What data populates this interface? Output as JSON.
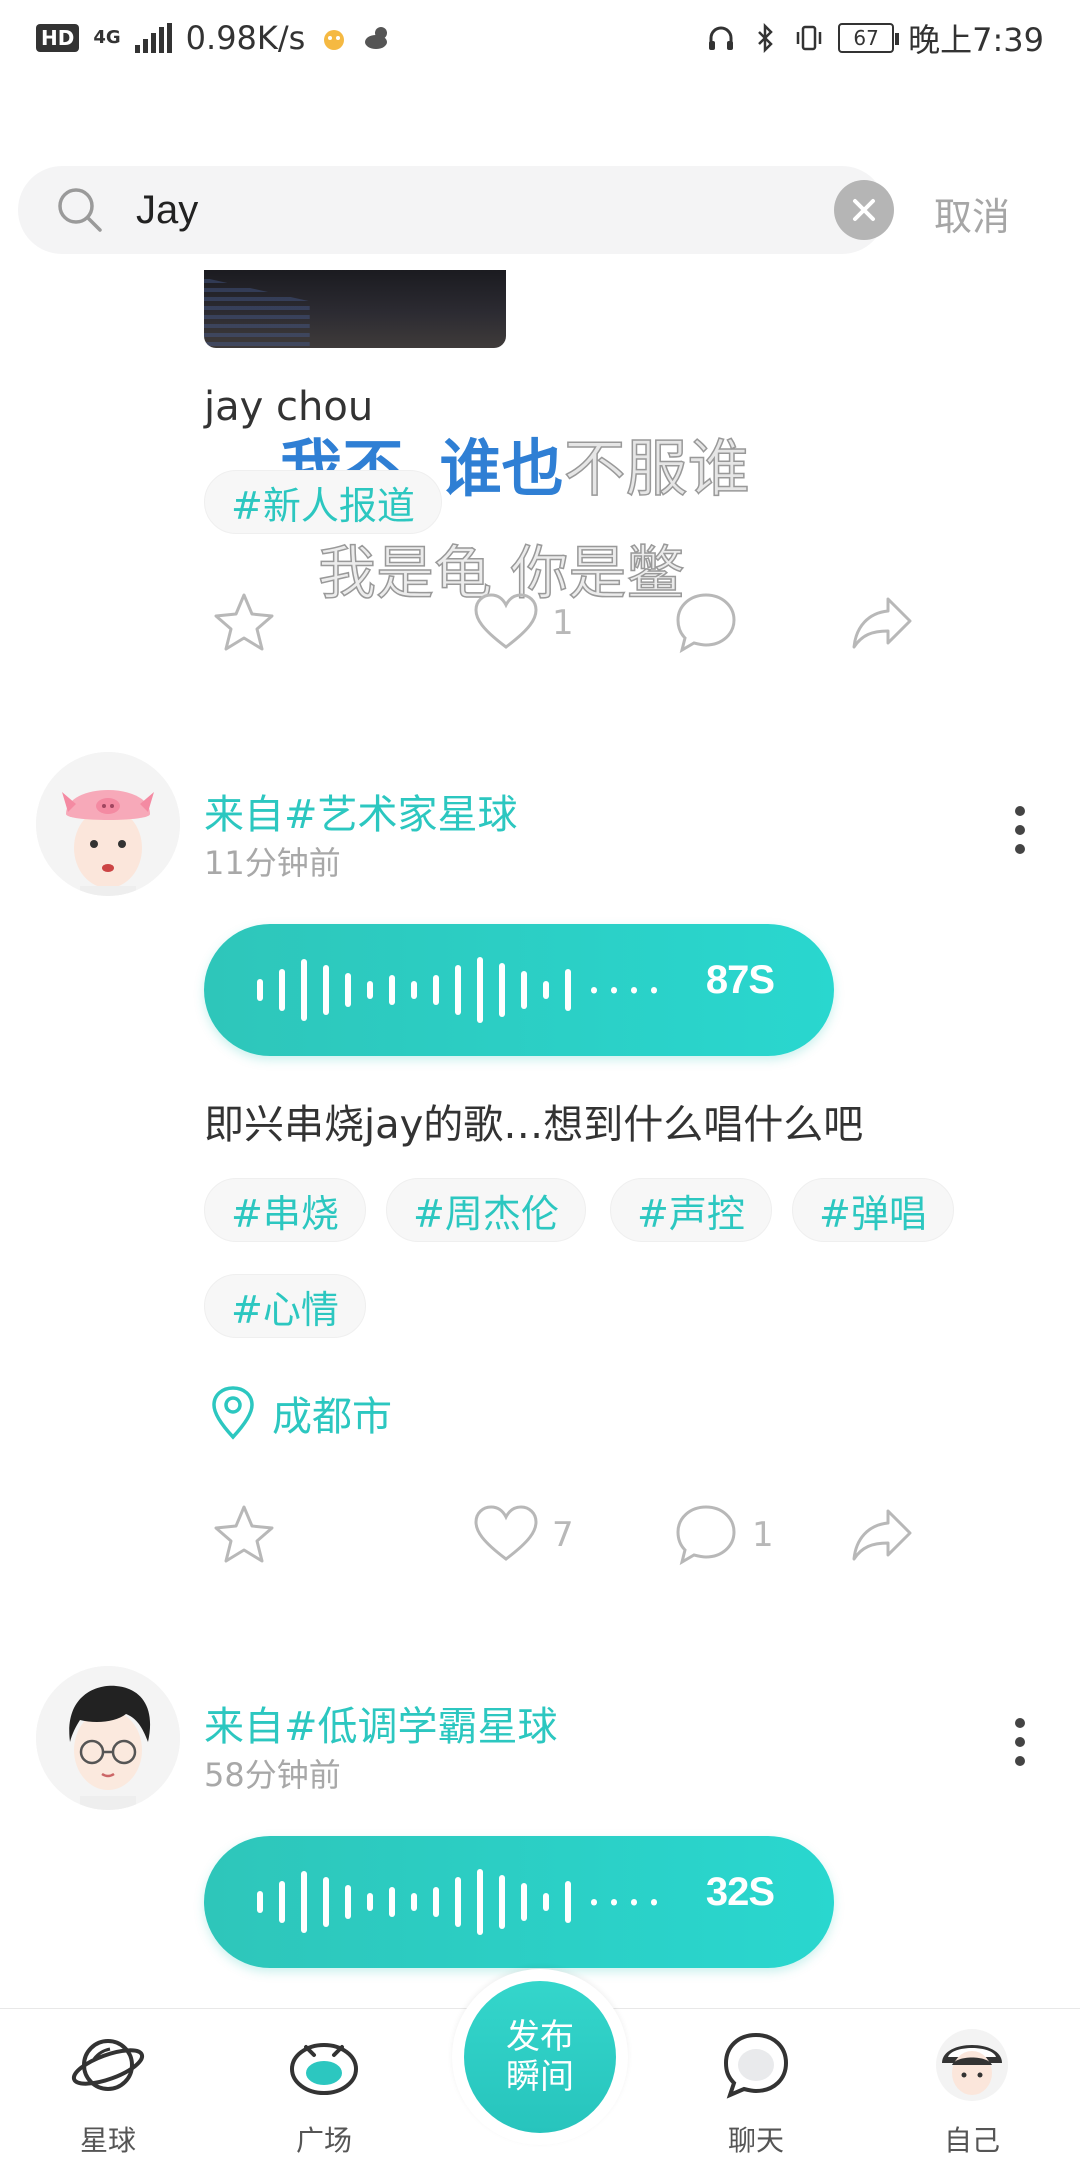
{
  "status_bar": {
    "hd": "HD",
    "network": "4G",
    "speed": "0.98K/s",
    "battery": "67",
    "time": "晚上7:39"
  },
  "search": {
    "query": "Jay",
    "cancel_label": "取消"
  },
  "post_top": {
    "text": "jay chou",
    "overlay_line1_a": "我丕",
    "overlay_line1_b": "谁也",
    "overlay_line1_c": "不服谁",
    "overlay_line2": "我是龟 你是鳖",
    "tags": [
      "#新人报道"
    ],
    "likes": "1"
  },
  "post_1": {
    "from": "来自#艺术家星球",
    "time_ago": "11分钟前",
    "voice_duration": "87S",
    "text": "即兴串烧jay的歌…想到什么唱什么吧",
    "tags": [
      "#串烧",
      "#周杰伦",
      "#声控",
      "#弹唱",
      "#心情"
    ],
    "location": "成都市",
    "likes": "7",
    "comments": "1"
  },
  "post_2": {
    "from": "来自#低调学霸星球",
    "time_ago": "58分钟前",
    "voice_duration": "32S"
  },
  "bottom_nav": {
    "items": [
      "星球",
      "广场",
      "聊天",
      "自己"
    ],
    "publish": "发布瞬间"
  },
  "colors": {
    "accent": "#2cc7c0",
    "overlay_blue": "#2f7fd4",
    "muted": "#b8b8b8"
  },
  "icons": [
    "search-icon",
    "clear-icon",
    "star-icon",
    "heart-icon",
    "comment-icon",
    "share-icon",
    "more-icon",
    "location-icon",
    "planet-icon",
    "square-icon",
    "chat-icon",
    "profile-avatar-icon"
  ]
}
